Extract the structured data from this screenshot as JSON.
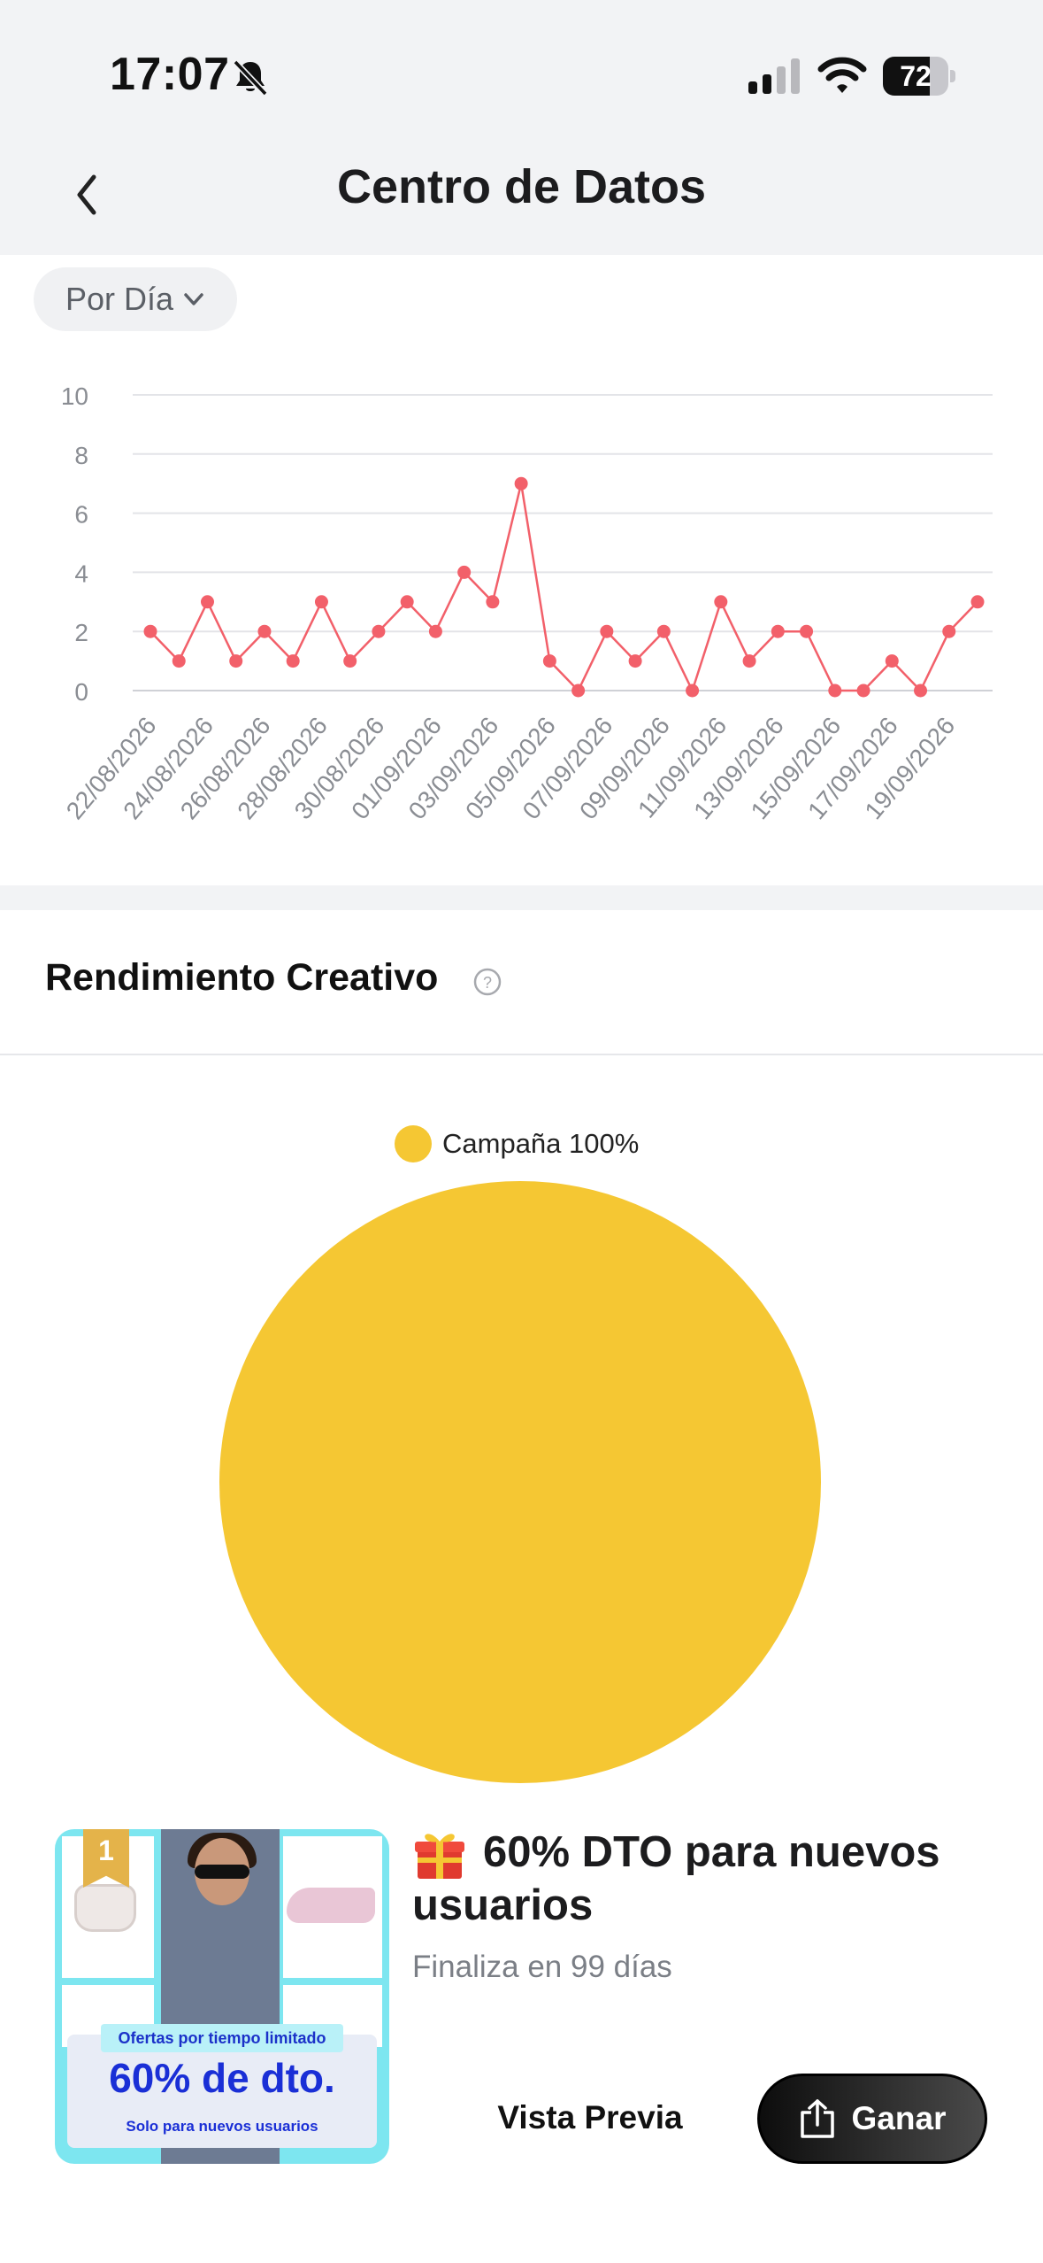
{
  "status_bar": {
    "time": "17:07",
    "battery": "72",
    "battery_percent": 72
  },
  "header": {
    "title": "Centro de Datos",
    "back_icon": "chevron-left-icon"
  },
  "filter": {
    "label": "Por Día"
  },
  "chart_data": {
    "type": "line",
    "color": "#f2606a",
    "x": [
      "22/08/2026",
      "23/08/2026",
      "24/08/2026",
      "25/08/2026",
      "26/08/2026",
      "27/08/2026",
      "28/08/2026",
      "29/08/2026",
      "30/08/2026",
      "31/08/2026",
      "01/09/2026",
      "02/09/2026",
      "03/09/2026",
      "04/09/2026",
      "05/09/2026",
      "06/09/2026",
      "07/09/2026",
      "08/09/2026",
      "09/09/2026",
      "10/09/2026",
      "11/09/2026",
      "12/09/2026",
      "13/09/2026",
      "14/09/2026",
      "15/09/2026",
      "16/09/2026",
      "17/09/2026",
      "18/09/2026",
      "19/09/2026",
      "20/09/2026"
    ],
    "values": [
      2,
      1,
      3,
      1,
      2,
      1,
      3,
      1,
      2,
      3,
      2,
      4,
      3,
      7,
      1,
      0,
      2,
      1,
      2,
      0,
      3,
      1,
      2,
      2,
      0,
      0,
      1,
      0,
      2,
      3
    ],
    "x_tick_labels": [
      "22/08/2026",
      "24/08/2026",
      "26/08/2026",
      "28/08/2026",
      "30/08/2026",
      "01/09/2026",
      "03/09/2026",
      "05/09/2026",
      "07/09/2026",
      "09/09/2026",
      "11/09/2026",
      "13/09/2026",
      "15/09/2026",
      "17/09/2026",
      "19/09/2026"
    ],
    "y_ticks": [
      0,
      2,
      4,
      6,
      8,
      10
    ],
    "ylim": [
      0,
      10
    ],
    "grid": true
  },
  "creative": {
    "title": "Rendimiento Creativo",
    "help_icon": "question-circle-icon",
    "pie": {
      "type": "pie",
      "slices": [
        {
          "name": "Campaña",
          "value": 100,
          "color": "#f5c733"
        }
      ],
      "legend_text": "Campaña 100%"
    }
  },
  "offer": {
    "gift_icon": "gift-icon",
    "title": "60% DTO para nuevos usuarios",
    "subtitle": "Finaliza en 99 días",
    "image": {
      "rank": "1",
      "top_text": "Ofertas por tiempo limitado",
      "big_text": "60% de dto.",
      "small_text": "Solo para nuevos usuarios"
    },
    "preview_label": "Vista Previa",
    "earn_label": "Ganar",
    "earn_icon": "share-icon"
  }
}
